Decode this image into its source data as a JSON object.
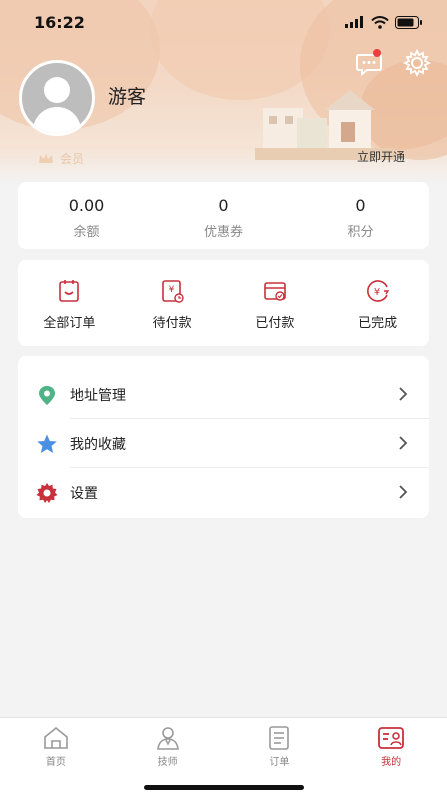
{
  "status_bar": {
    "time": "16:22"
  },
  "profile": {
    "username": "游客",
    "member_label": "会员",
    "activate_label": "立即开通"
  },
  "stats": [
    {
      "value": "0.00",
      "label": "余额"
    },
    {
      "value": "0",
      "label": "优惠券"
    },
    {
      "value": "0",
      "label": "积分"
    }
  ],
  "orders": [
    {
      "label": "全部订单",
      "icon": "all-orders-icon"
    },
    {
      "label": "待付款",
      "icon": "pending-payment-icon"
    },
    {
      "label": "已付款",
      "icon": "paid-icon"
    },
    {
      "label": "已完成",
      "icon": "completed-icon"
    }
  ],
  "menu": [
    {
      "label": "地址管理",
      "icon": "location-pin-icon"
    },
    {
      "label": "我的收藏",
      "icon": "star-icon"
    },
    {
      "label": "设置",
      "icon": "gear-icon"
    }
  ],
  "tabbar": [
    {
      "label": "首页",
      "icon": "home-icon"
    },
    {
      "label": "技师",
      "icon": "technician-icon"
    },
    {
      "label": "订单",
      "icon": "orders-icon"
    },
    {
      "label": "我的",
      "icon": "profile-icon"
    }
  ],
  "colors": {
    "accent": "#c8303b",
    "pin": "#4fb387",
    "star": "#4a90e2",
    "gear": "#c8303b"
  }
}
